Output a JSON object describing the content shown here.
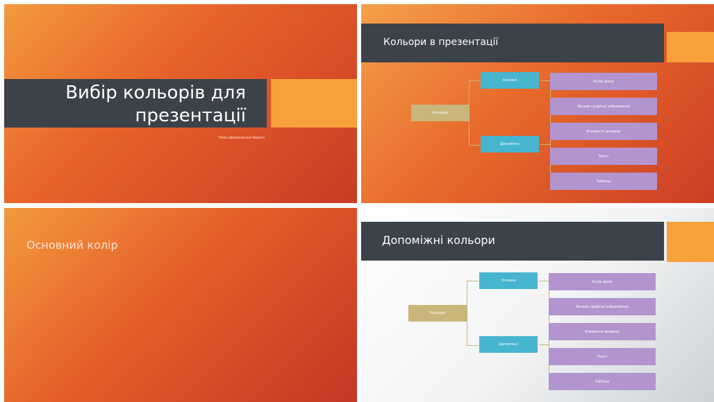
{
  "slides": [
    {
      "title": "Вибір кольорів для презентації",
      "subtitle": "Тема оформлення Берлін"
    },
    {
      "title": "Кольори в презентації",
      "diagram": {
        "root": "Кольори",
        "branches": [
          "Основні",
          "Допоміжні"
        ],
        "leaves": [
          "Колір фону",
          "Фонові графічні зображення",
          "Елементи дизайну",
          "Текст",
          "Таблиці"
        ]
      }
    },
    {
      "title": "Основний колір"
    },
    {
      "title": "Допоміжні кольори",
      "diagram": {
        "root": "Кольори",
        "branches": [
          "Основні",
          "Допоміжні"
        ],
        "leaves": [
          "Колір фону",
          "Фонові графічні зображення",
          "Елементи дизайну",
          "Текст",
          "Таблиці"
        ]
      }
    }
  ],
  "colors": {
    "dark_bar": "#3c4249",
    "accent_orange": "#f7a13a",
    "root_box": "#c9b67a",
    "branch_box": "#47b5cf",
    "leaf_box": "#b295cf"
  }
}
